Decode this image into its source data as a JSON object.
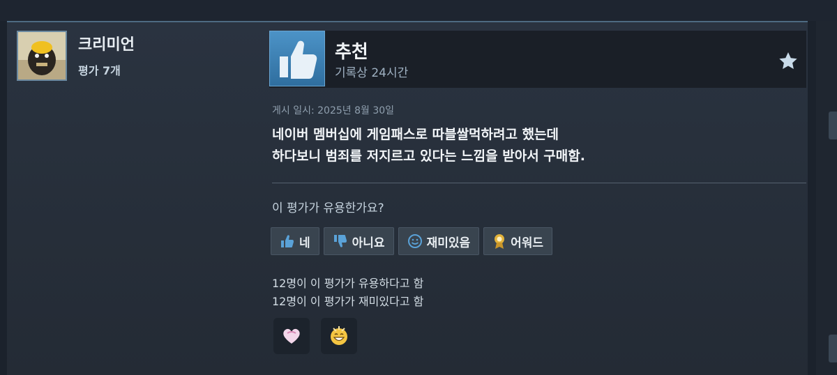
{
  "author": {
    "name": "크리미언",
    "review_count": "평가 7개"
  },
  "review": {
    "verdict": "추천",
    "hours": "기록상 24시간",
    "posted": "게시 일시: 2025년 8월 30일",
    "text_line1": "네이버 멤버십에 게임패스로 따블쌀먹하려고 했는데",
    "text_line2": "하다보니 범죄를 저지르고 있다는 느낌을 받아서 구매함."
  },
  "helpful": {
    "question": "이 평가가 유용한가요?",
    "buttons": {
      "yes": "네",
      "no": "아니요",
      "funny": "재미있음",
      "award": "어워드"
    },
    "stat_helpful": "12명이 이 평가가 유용하다고 함",
    "stat_funny": "12명이 이 평가가 재미있다고 함"
  },
  "icons": [
    "thumbs-up-icon",
    "star-icon",
    "thumbs-down-icon",
    "smiley-icon",
    "award-ribbon-icon",
    "heart-award-icon",
    "laughing-award-icon"
  ],
  "colors": {
    "card_bg": "#2a3340",
    "header_bg": "#1a1f27",
    "thumb_blue": "#4c93c7",
    "button_bg": "#39444f",
    "accent_gold": "#e2b23a"
  }
}
